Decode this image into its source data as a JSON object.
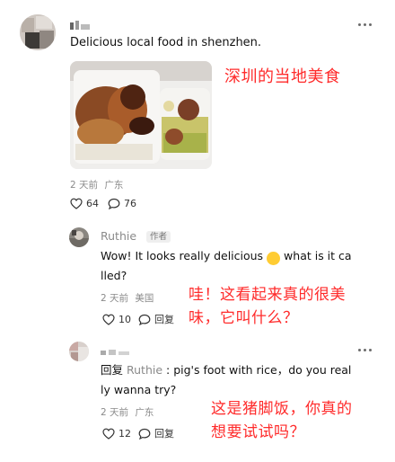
{
  "post": {
    "username": "",
    "text": "Delicious local food in shenzhen.",
    "time": "2 天前",
    "location": "广东",
    "likes": "64",
    "comments": "76",
    "annotation": "深圳的当地美食"
  },
  "comment1": {
    "username": "Ruthie",
    "author_badge": "作者",
    "text_a": "Wow! It looks really delicious",
    "emoji": "😋",
    "text_b": "what is it ca",
    "text_c": "lled?",
    "time": "2 天前",
    "location": "美国",
    "likes": "10",
    "reply_label": "回复",
    "annotation_line1": "哇！这看起来真的很美",
    "annotation_line2": "味，它叫什么？"
  },
  "comment2": {
    "username": "",
    "reply_prefix": "回复",
    "reply_to": "Ruthie",
    "text_a": ": pig's foot with rice，do you real",
    "text_b": "ly wanna try?",
    "time": "2 天前",
    "location": "广东",
    "likes": "12",
    "reply_label": "回复",
    "annotation_line1": "这是猪脚饭，你真的",
    "annotation_line2": "想要试试吗？"
  },
  "icons": {
    "more": "more-dots-icon",
    "heart": "heart-icon",
    "comment": "comment-bubble-icon"
  },
  "colors": {
    "annotation": "#ff2b2b",
    "meta": "#8a8a8a"
  }
}
